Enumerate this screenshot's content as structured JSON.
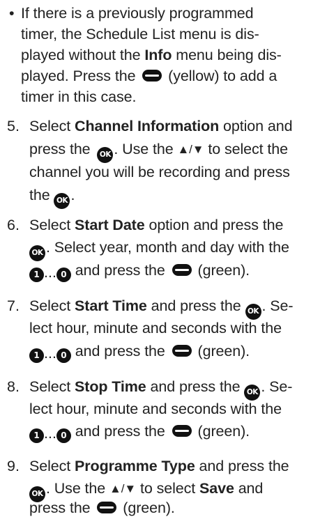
{
  "bullet_note": {
    "marker": "•",
    "l1": "If there is a previously programmed",
    "l2": "timer, the Schedule List menu is dis-",
    "l3a": "played without the ",
    "l3b": "Info",
    "l3c": " menu being dis-",
    "l4a": "played. Press the ",
    "l4b": " (yellow) to add a",
    "l5": "timer in this case."
  },
  "step5": {
    "num": "5.",
    "l1a": "Select ",
    "l1b": "Channel Information",
    "l1c": " option and",
    "l2a": "press the ",
    "l2b": ". Use the ",
    "l2c": " to select the",
    "l3": "channel you will be recording and press",
    "l4a": "the ",
    "l4b": "."
  },
  "step6": {
    "num": "6.",
    "l1a": "Select ",
    "l1b": "Start Date",
    "l1c": " option and press the",
    "l2a": ". Select year, month and day with the",
    "l3a": " and press the ",
    "l3b": " (green)."
  },
  "step7": {
    "num": "7.",
    "l1a": "Select ",
    "l1b": "Start Time",
    "l1c": " and press the ",
    "l1d": ". Se-",
    "l2": "lect hour, minute and seconds with the",
    "l3a": " and press the ",
    "l3b": " (green)."
  },
  "step8": {
    "num": "8.",
    "l1a": "Select ",
    "l1b": "Stop Time",
    "l1c": " and press the ",
    "l1d": ". Se-",
    "l2": "lect hour, minute and seconds with the",
    "l3a": " and press the ",
    "l3b": " (green)."
  },
  "step9": {
    "num": "9.",
    "l1a": "Select ",
    "l1b": "Programme Type",
    "l1c": " and press the",
    "l2a": ". Use the ",
    "l2b": " to select ",
    "l2c": "Save",
    "l2d": " and",
    "l3a": "press the ",
    "l3b": " (green)."
  },
  "keys": {
    "ok": "OK",
    "one": "1",
    "zero": "0",
    "dots": "...",
    "up_down": "▲/▼"
  }
}
